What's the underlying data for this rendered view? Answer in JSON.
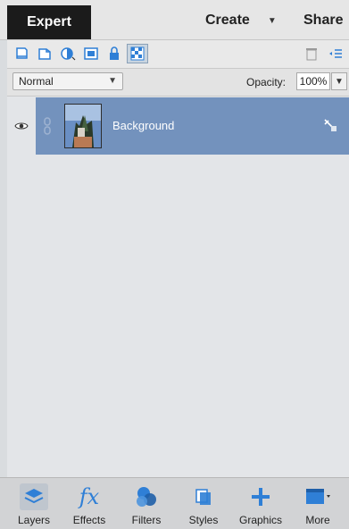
{
  "header": {
    "mode_tab": "Expert",
    "create_label": "Create",
    "share_label": "Share"
  },
  "toolbar": {
    "icons": [
      "new-layer-icon",
      "new-group-icon",
      "adjustment-layer-icon",
      "add-mask-icon",
      "lock-all-icon",
      "lock-transparent-icon",
      "trash-icon",
      "panel-menu-icon"
    ]
  },
  "blend": {
    "mode": "Normal",
    "opacity_label": "Opacity:",
    "opacity_value": "100%"
  },
  "layers": [
    {
      "name": "Background",
      "selected": true,
      "visible": true
    }
  ],
  "bottom": {
    "items": [
      {
        "label": "Layers",
        "icon": "layers-icon"
      },
      {
        "label": "Effects",
        "icon": "fx-icon"
      },
      {
        "label": "Filters",
        "icon": "filters-icon"
      },
      {
        "label": "Styles",
        "icon": "styles-icon"
      },
      {
        "label": "Graphics",
        "icon": "plus-icon"
      },
      {
        "label": "More",
        "icon": "more-panel-icon"
      }
    ]
  },
  "colors": {
    "selected_row": "#7392bd",
    "accent_blue": "#2f7fd6",
    "dark_tab": "#1b1b1b"
  }
}
